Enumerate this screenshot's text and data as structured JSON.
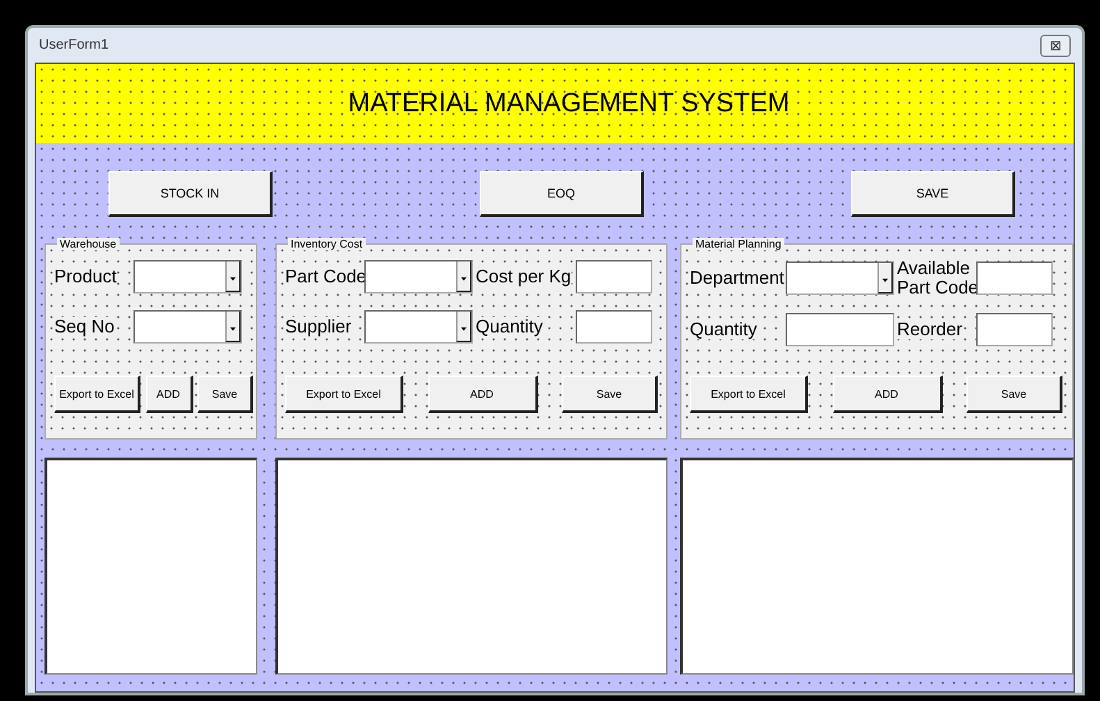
{
  "window": {
    "title": "UserForm1",
    "close": "⊠"
  },
  "header": {
    "title": "MATERIAL MANAGEMENT SYSTEM"
  },
  "top_buttons": [
    "STOCK IN",
    "EOQ",
    "SAVE"
  ],
  "panels": [
    {
      "title": "Warehouse",
      "rows": [
        [
          {
            "label": "Product",
            "kind": "combo"
          }
        ],
        [
          {
            "label": "Seq No",
            "kind": "combo"
          }
        ]
      ],
      "buttons": [
        "Export to Excel",
        "ADD",
        "Save"
      ]
    },
    {
      "title": "Inventory Cost",
      "rows": [
        [
          {
            "label": "Part Code",
            "kind": "combo"
          },
          {
            "label": "Cost per Kg",
            "kind": "text"
          }
        ],
        [
          {
            "label": "Supplier",
            "kind": "combo"
          },
          {
            "label": "Quantity",
            "kind": "text"
          }
        ]
      ],
      "buttons": [
        "Export to Excel",
        "ADD",
        "Save"
      ]
    },
    {
      "title": "Material Planning",
      "rows": [
        [
          {
            "label": "Department",
            "kind": "combo"
          },
          {
            "label": "Available\nPart Code",
            "kind": "text"
          }
        ],
        [
          {
            "label": "Quantity",
            "kind": "text"
          },
          {
            "label": "Reorder",
            "kind": "text"
          }
        ]
      ],
      "buttons": [
        "Export to Excel",
        "ADD",
        "Save"
      ]
    }
  ]
}
